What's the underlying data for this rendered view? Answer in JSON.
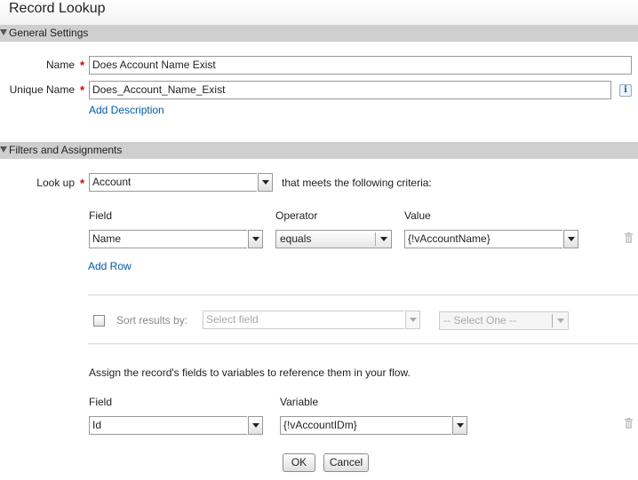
{
  "window": {
    "title": "Record Lookup"
  },
  "sections": {
    "general": "General Settings",
    "filters": "Filters and Assignments"
  },
  "general": {
    "name_label": "Name",
    "name_value": "Does Account Name Exist",
    "unique_label": "Unique Name",
    "unique_value": "Does_Account_Name_Exist",
    "add_description": "Add Description",
    "required_marker": "*",
    "info_icon": "info-icon"
  },
  "lookup": {
    "label": "Look up",
    "object": "Account",
    "criteria_text": "that meets the following criteria:"
  },
  "filters": {
    "headers": {
      "field": "Field",
      "operator": "Operator",
      "value": "Value"
    },
    "rows": [
      {
        "field": "Name",
        "operator": "equals",
        "value": "{!vAccountName}"
      }
    ],
    "add_row": "Add Row"
  },
  "sort": {
    "checked": false,
    "label": "Sort results by:",
    "field_placeholder": "Select field",
    "order_value": "-- Select One --"
  },
  "assignments": {
    "intro": "Assign the record's fields to variables to reference them in your flow.",
    "headers": {
      "field": "Field",
      "variable": "Variable"
    },
    "rows": [
      {
        "field": "Id",
        "variable": "{!vAccountIDm}"
      }
    ]
  },
  "icons": {
    "delete": "trash-icon",
    "collapse": "triangle-down-icon",
    "dropdown": "chevron-down-icon"
  },
  "colors": {
    "section_bg": "#cfcfcf",
    "link": "#015ba7",
    "required": "#cc0000"
  },
  "buttons": {
    "ok": "OK",
    "cancel": "Cancel"
  }
}
